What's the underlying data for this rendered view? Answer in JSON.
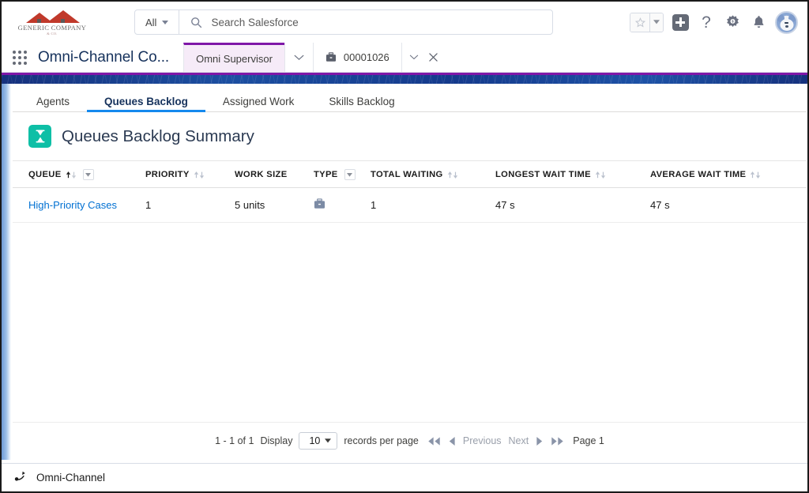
{
  "header": {
    "logo": {
      "name": "GENERIC COMPANY",
      "tagline": "& CO."
    },
    "search": {
      "scope": "All",
      "placeholder": "Search Salesforce",
      "value": ""
    },
    "actions": {
      "favorites": "favorites-star",
      "favorites_menu": "favorites-dropdown",
      "add": "add-item",
      "help": "?",
      "setup": "setup-gear",
      "notifications": "notifications-bell",
      "avatar": "user-avatar"
    }
  },
  "appnav": {
    "launcher": "app-launcher",
    "app_name": "Omni-Channel Co...",
    "tabs": [
      {
        "label": "Omni Supervisor",
        "active": true,
        "icon": null,
        "closable": false
      },
      {
        "label": "00001026",
        "active": false,
        "icon": "briefcase-icon",
        "closable": true
      }
    ]
  },
  "subtabs": [
    {
      "label": "Agents",
      "active": false
    },
    {
      "label": "Queues Backlog",
      "active": true
    },
    {
      "label": "Assigned Work",
      "active": false
    },
    {
      "label": "Skills Backlog",
      "active": false
    }
  ],
  "page": {
    "icon": "hourglass-icon",
    "icon_color": "#0ebfa6",
    "title": "Queues Backlog Summary"
  },
  "table": {
    "columns": [
      {
        "label": "QUEUE",
        "sort": "asc",
        "has_menu": true
      },
      {
        "label": "PRIORITY",
        "sort": "none",
        "has_menu": false
      },
      {
        "label": "WORK SIZE",
        "sort": "none",
        "has_menu": false
      },
      {
        "label": "TYPE",
        "sort": "none",
        "has_menu": true
      },
      {
        "label": "TOTAL WAITING",
        "sort": "none",
        "has_menu": false
      },
      {
        "label": "LONGEST WAIT TIME",
        "sort": "none",
        "has_menu": false
      },
      {
        "label": "AVERAGE WAIT TIME",
        "sort": "none",
        "has_menu": false
      }
    ],
    "rows": [
      {
        "queue": "High-Priority Cases",
        "priority": "1",
        "work_size": "5 units",
        "type_icon": "briefcase-icon",
        "total_waiting": "1",
        "longest_wait_time": "47 s",
        "average_wait_time": "47 s"
      }
    ]
  },
  "pagination": {
    "range": "1 - 1 of 1",
    "display_label": "Display",
    "page_size": "10",
    "records_label": "records per page",
    "first": "first-page",
    "prev_arrow": "previous-page",
    "previous": "Previous",
    "next": "Next",
    "next_arrow": "next-page",
    "last": "last-page",
    "page_indicator": "Page 1"
  },
  "footer": {
    "icon": "omni-channel-icon",
    "label": "Omni-Channel"
  },
  "colors": {
    "brand_purple": "#7f17a8",
    "link_blue": "#0070d2",
    "active_tab_blue": "#1589ee",
    "object_teal": "#0ebfa6",
    "banner_blue": "#16317d"
  }
}
